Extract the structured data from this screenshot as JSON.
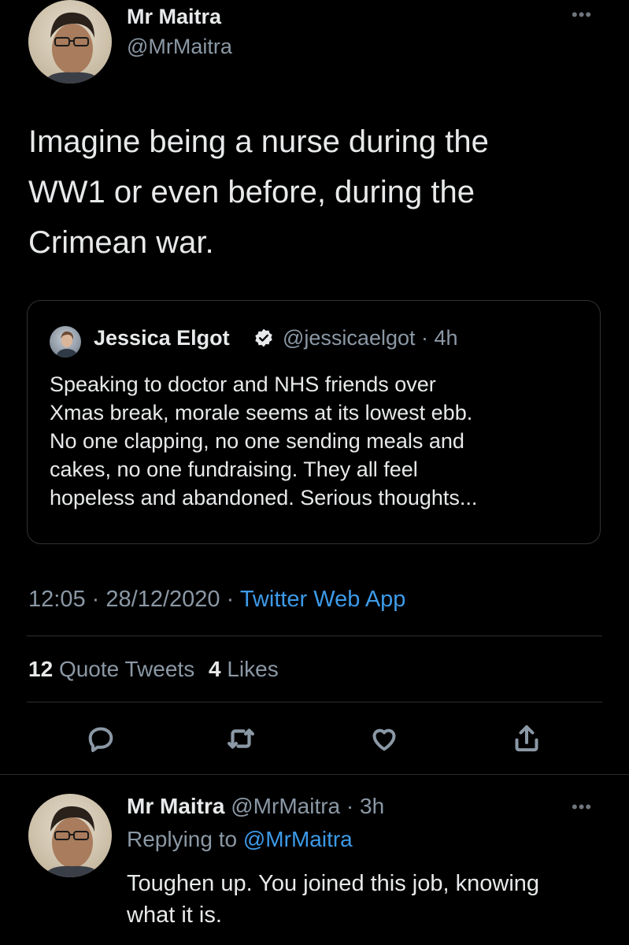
{
  "main_tweet": {
    "author_name": "Mr Maitra",
    "handle": "@MrMaitra",
    "more_label": "•••",
    "text_line1": "Imagine being a nurse during the",
    "text_line2": "WW1 or even before, during the",
    "text_line3": "Crimean war.",
    "quoted": {
      "author_name": "Jessica Elgot",
      "handle": "@jessicaelgot",
      "separator": "·",
      "age": "4h",
      "verified": true,
      "line1": "Speaking to doctor and NHS friends over",
      "line2": "Xmas break, morale seems at its lowest ebb.",
      "line3": "No one clapping, no one sending meals and",
      "line4": "cakes, no one fundraising. They all feel",
      "line5": "hopeless and abandoned. Serious thoughts..."
    },
    "meta": {
      "time": "12:05",
      "sep1": "·",
      "date": "28/12/2020",
      "sep2": "·",
      "source": "Twitter Web App"
    },
    "stats": {
      "quote_count": "12",
      "quote_label": "Quote Tweets",
      "like_count": "4",
      "like_label": "Likes"
    },
    "actions": [
      "reply-icon",
      "retweet-icon",
      "like-icon",
      "share-icon"
    ]
  },
  "reply_tweet": {
    "author_name": "Mr Maitra",
    "handle": "@MrMaitra",
    "separator": "·",
    "age": "3h",
    "more_label": "•••",
    "replying_prefix": "Replying to",
    "replying_to": "@MrMaitra",
    "text_line1": "Toughen up. You joined this job, knowing",
    "text_line2": "what it is."
  },
  "colors": {
    "background": "#000000",
    "text": "#d9d9d9",
    "muted": "#8b98a5",
    "link": "#3d9ae8",
    "divider": "#2a2d30"
  }
}
